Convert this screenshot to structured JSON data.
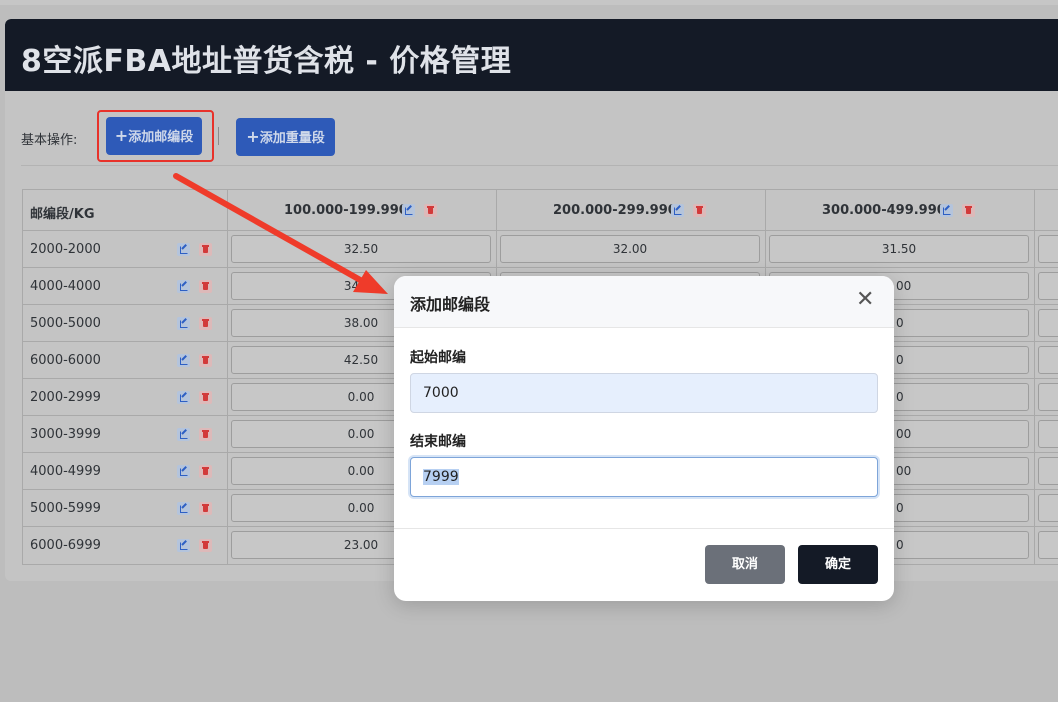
{
  "header": {
    "title": "8空派FBA地址普货含税 - 价格管理"
  },
  "toolbar": {
    "ops_label": "基本操作:",
    "add_postal_label": "添加邮编段",
    "add_weight_label": "添加重量段",
    "plus": "+"
  },
  "table": {
    "corner_label": "邮编段/KG",
    "columns": [
      {
        "label": "100.000-199.990"
      },
      {
        "label": "200.000-299.990"
      },
      {
        "label": "300.000-499.990"
      }
    ],
    "rows": [
      {
        "label": "2000-2000",
        "values": [
          "32.50",
          "32.00",
          "31.50"
        ]
      },
      {
        "label": "4000-4000",
        "values": [
          "34.00",
          "",
          "00"
        ]
      },
      {
        "label": "5000-5000",
        "values": [
          "38.00",
          "",
          "0"
        ]
      },
      {
        "label": "6000-6000",
        "values": [
          "42.50",
          "",
          "0"
        ]
      },
      {
        "label": "2000-2999",
        "values": [
          "0.00",
          "",
          "0"
        ]
      },
      {
        "label": "3000-3999",
        "values": [
          "0.00",
          "",
          "00"
        ]
      },
      {
        "label": "4000-4999",
        "values": [
          "0.00",
          "",
          "00"
        ]
      },
      {
        "label": "5000-5999",
        "values": [
          "0.00",
          "",
          "0"
        ]
      },
      {
        "label": "6000-6999",
        "values": [
          "23.00",
          "",
          "0"
        ]
      }
    ]
  },
  "modal": {
    "title": "添加邮编段",
    "close_glyph": "✕",
    "start_label": "起始邮编",
    "start_value": "7000",
    "end_label": "结束邮编",
    "end_value": "7999",
    "cancel_label": "取消",
    "confirm_label": "确定"
  },
  "colors": {
    "header_bg": "#141a26",
    "primary_button": "#2e5ab8",
    "highlight_red": "#e8322a",
    "cancel_button": "#6b7079"
  }
}
